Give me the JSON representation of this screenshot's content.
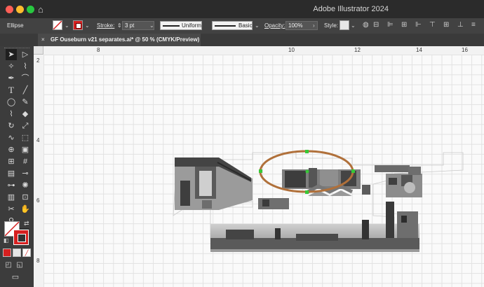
{
  "app": {
    "title": "Adobe Illustrator 2024"
  },
  "control_bar": {
    "selection_type": "Ellipse",
    "stroke_label": "Stroke:",
    "stroke_value": "3 pt",
    "stroke_profile": "Uniform",
    "brush": "Basic",
    "opacity_label": "Opacity:",
    "opacity_value": "100%",
    "style_label": "Style:"
  },
  "document": {
    "tab_title": "GF Ouseburn v21 separates.ai* @ 50 % (CMYK/Preview)"
  },
  "rulers": {
    "horizontal": [
      "8",
      "10",
      "12",
      "14",
      "16"
    ],
    "vertical": [
      "2",
      "4",
      "6",
      "8"
    ]
  },
  "colors": {
    "stroke_swatch": "#d62020",
    "ellipse_stroke": "#b0703a",
    "anchor": "#37c837"
  }
}
